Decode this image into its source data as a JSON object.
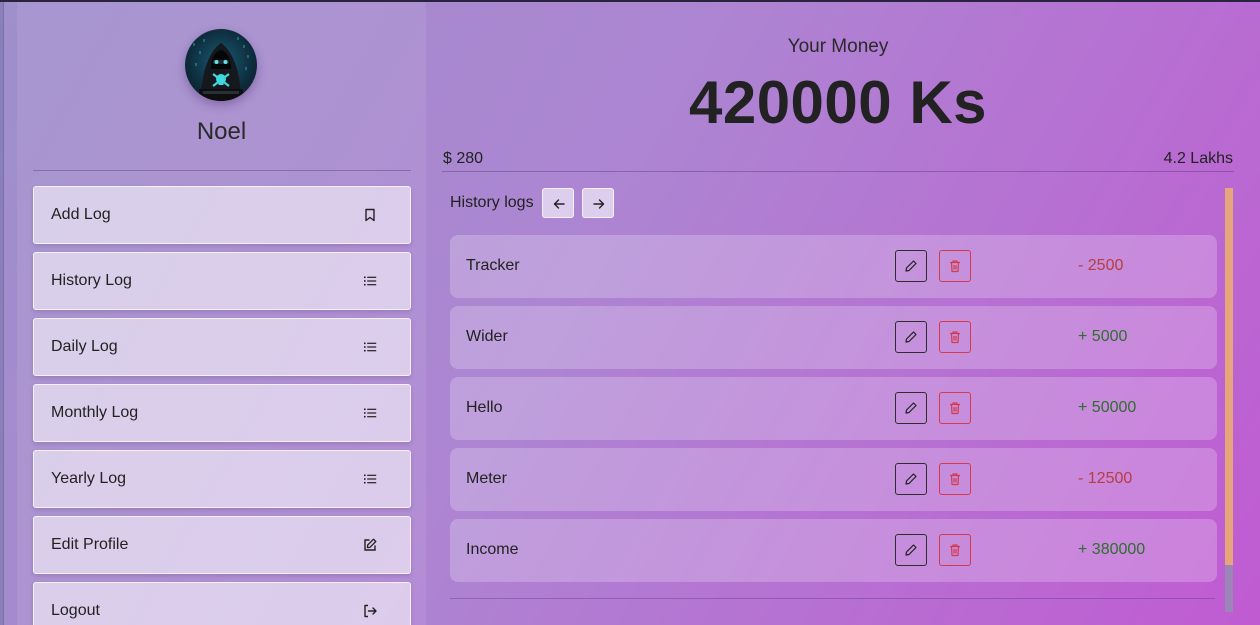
{
  "profile": {
    "name": "Noel",
    "avatar_icon": "hooded-hacker-avatar"
  },
  "sidebar": {
    "items": [
      {
        "label": "Add Log",
        "icon": "bookmark-icon"
      },
      {
        "label": "History Log",
        "icon": "list-icon"
      },
      {
        "label": "Daily Log",
        "icon": "list-icon"
      },
      {
        "label": "Monthly Log",
        "icon": "list-icon"
      },
      {
        "label": "Yearly Log",
        "icon": "list-icon"
      },
      {
        "label": "Edit Profile",
        "icon": "edit-square-icon"
      },
      {
        "label": "Logout",
        "icon": "logout-icon"
      }
    ]
  },
  "money": {
    "title": "Your Money",
    "amount": "420000 Ks",
    "usd": "$ 280",
    "lakhs": "4.2 Lakhs"
  },
  "history": {
    "title": "History logs",
    "prev_icon": "arrow-left-icon",
    "next_icon": "arrow-right-icon",
    "logs": [
      {
        "name": "Tracker",
        "amount": "- 2500",
        "type": "negative"
      },
      {
        "name": "Wider",
        "amount": "+ 5000",
        "type": "positive"
      },
      {
        "name": "Hello",
        "amount": "+ 50000",
        "type": "positive"
      },
      {
        "name": "Meter",
        "amount": "- 12500",
        "type": "negative"
      },
      {
        "name": "Income",
        "amount": "+ 380000",
        "type": "positive"
      }
    ]
  },
  "colors": {
    "negative": "#b63e3e",
    "positive": "#2e6e2e",
    "delete": "#d6394a",
    "scroll_thumb": "#e6a57a"
  }
}
